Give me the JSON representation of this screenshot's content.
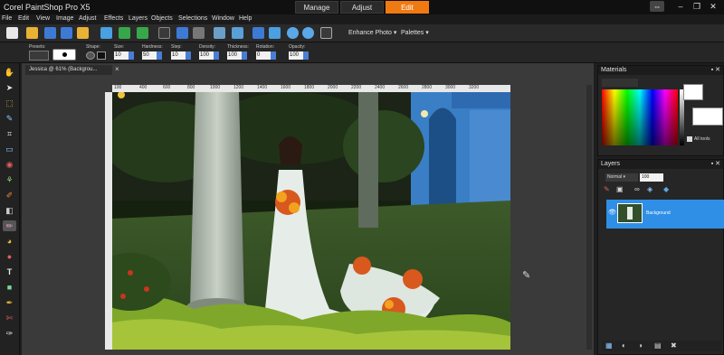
{
  "app": {
    "title": "Corel PaintShop Pro X5"
  },
  "mode_tabs": [
    {
      "label": "Manage",
      "active": false
    },
    {
      "label": "Adjust",
      "active": false
    },
    {
      "label": "Edit",
      "active": true
    }
  ],
  "window_controls": [
    "⇔",
    "–",
    "❐",
    "✕"
  ],
  "menu": [
    "File",
    "Edit",
    "View",
    "Image",
    "Adjust",
    "Effects",
    "Layers",
    "Objects",
    "Selections",
    "Window",
    "Help"
  ],
  "toolbar": {
    "enhance_photo": "Enhance Photo",
    "palettes": "Palettes"
  },
  "tool_options": {
    "presets_label": "Presets:",
    "shape_label": "Shape:",
    "size_label": "Size:",
    "size": "10",
    "hardness_label": "Hardness:",
    "hardness": "50",
    "step_label": "Step:",
    "step": "10",
    "density_label": "Density:",
    "density": "100",
    "thickness_label": "Thickness:",
    "thickness": "100",
    "rotation_label": "Rotation:",
    "rotation": "0",
    "opacity_label": "Opacity:",
    "opacity": "100"
  },
  "document": {
    "tab_label": "Jessica @ 61% (Backgrou...",
    "ruler_ticks": [
      "100",
      "400",
      "600",
      "800",
      "1000",
      "1200",
      "1400",
      "1600",
      "1800",
      "2000",
      "2200",
      "2400",
      "2600",
      "2800",
      "3000",
      "3200"
    ]
  },
  "materials": {
    "title": "Materials",
    "all_tools": "All tools"
  },
  "layers": {
    "title": "Layers",
    "blend_mode": "Normal",
    "opacity": "100",
    "layer_name": "Background"
  },
  "colors": {
    "accent": "#f07a12",
    "selection": "#2f8fe6"
  }
}
